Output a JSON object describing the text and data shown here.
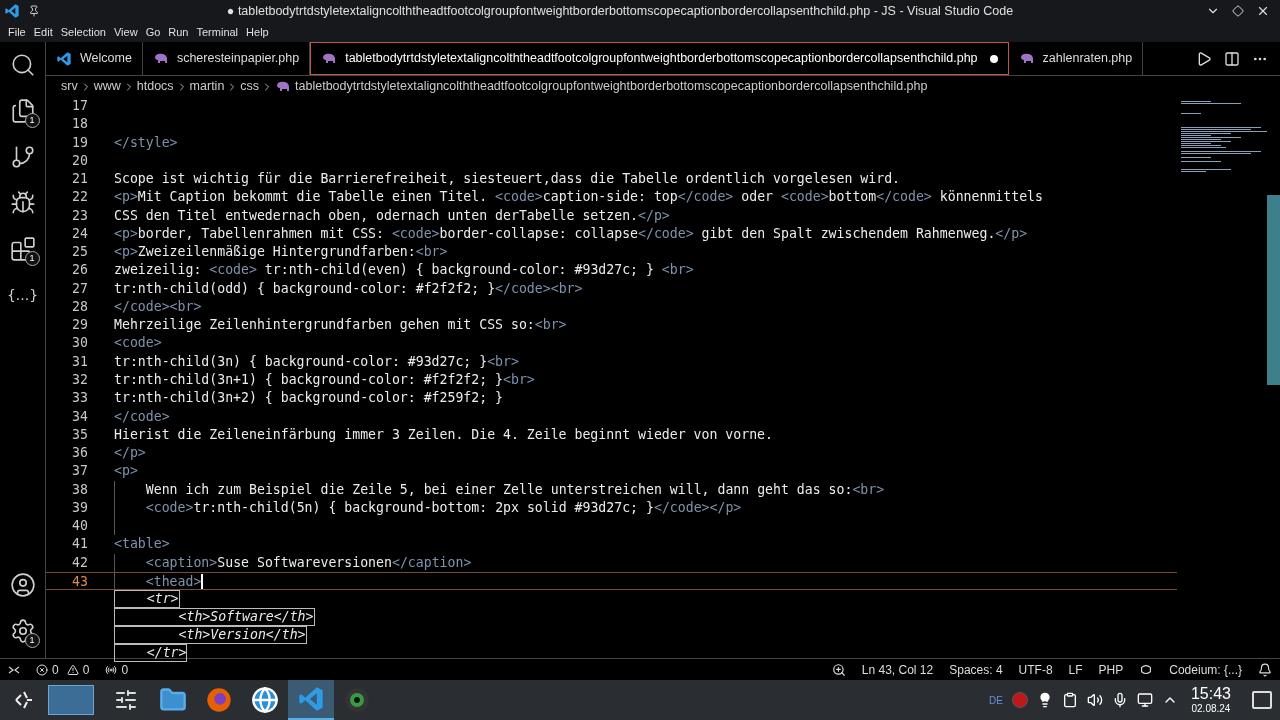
{
  "window": {
    "title": "● tabletbodytrtdstyletextaligncolththeadtfootcolgroupfontweightborderbottomscopecaptionbordercollapsenthchild.php - JS - Visual Studio Code"
  },
  "menu": [
    "File",
    "Edit",
    "Selection",
    "View",
    "Go",
    "Run",
    "Terminal",
    "Help"
  ],
  "activity_bar": [
    {
      "kind": "search"
    },
    {
      "kind": "files",
      "badge": "1"
    },
    {
      "kind": "source-control"
    },
    {
      "kind": "debug"
    },
    {
      "kind": "extensions",
      "badge": "1"
    },
    {
      "kind": "json",
      "label": "{...}"
    }
  ],
  "activity_bar_bottom": [
    {
      "kind": "account"
    },
    {
      "kind": "settings",
      "badge": "1"
    }
  ],
  "tabs": [
    {
      "label": "Welcome",
      "kind": "vscode",
      "selected": false,
      "modified": false
    },
    {
      "label": "scheresteinpapier.php",
      "kind": "php",
      "selected": false,
      "modified": false
    },
    {
      "label": "tabletbodytrtdstyletextaligncolththeadtfootcolgroupfontweightborderbottomscopecaptionbordercollapsenthchild.php",
      "kind": "php",
      "selected": true,
      "modified": true
    },
    {
      "label": "zahlenraten.php",
      "kind": "php",
      "selected": false,
      "modified": false
    }
  ],
  "breadcrumbs": [
    "srv",
    "www",
    "htdocs",
    "martin",
    "css",
    "tabletbodytrtdstyletextaligncolththeadtfootcolgroupfontweightborderbottomscopecaptionbordercollapsenthchild.php"
  ],
  "lines": [
    {
      "number": "17",
      "guide": false,
      "current": false
    },
    {
      "number": "18",
      "guide": false,
      "current": false
    },
    {
      "number": "19",
      "guide": false,
      "current": false,
      "segments": [
        {
          "kind": "tag",
          "text": "</style>"
        }
      ]
    },
    {
      "number": "20",
      "guide": false,
      "current": false
    },
    {
      "number": "21",
      "guide": false,
      "current": false,
      "segments": [
        {
          "kind": "text",
          "text": "Scope ist wichtig für die Barrierefreiheit, siesteuert,dass die Tabelle ordentlich vorgelesen wird."
        }
      ]
    },
    {
      "number": "22",
      "guide": false,
      "current": false,
      "segments": [
        {
          "kind": "tag",
          "text": "<p>"
        },
        {
          "kind": "text",
          "text": "Mit Caption bekommt die Tabelle einen Titel. "
        },
        {
          "kind": "tag",
          "text": "<code>"
        },
        {
          "kind": "text",
          "text": "caption-side: top"
        },
        {
          "kind": "tag",
          "text": "</code>"
        },
        {
          "kind": "text",
          "text": " oder "
        },
        {
          "kind": "tag",
          "text": "<code>"
        },
        {
          "kind": "text",
          "text": "bottom"
        },
        {
          "kind": "tag",
          "text": "</code>"
        },
        {
          "kind": "text",
          "text": " könnenmittels"
        }
      ]
    },
    {
      "number": "23",
      "guide": false,
      "current": false,
      "segments": [
        {
          "kind": "text",
          "text": "CSS den Titel entwedernach oben, odernach unten derTabelle setzen."
        },
        {
          "kind": "tag",
          "text": "</p>"
        }
      ]
    },
    {
      "number": "24",
      "guide": false,
      "current": false,
      "segments": [
        {
          "kind": "tag",
          "text": "<p>"
        },
        {
          "kind": "text",
          "text": "border, Tabellenrahmen mit CSS: "
        },
        {
          "kind": "tag",
          "text": "<code>"
        },
        {
          "kind": "text",
          "text": "border-collapse: collapse"
        },
        {
          "kind": "tag",
          "text": "</code>"
        },
        {
          "kind": "text",
          "text": " gibt den Spalt zwischendem Rahmenweg."
        },
        {
          "kind": "tag",
          "text": "</p>"
        }
      ]
    },
    {
      "number": "25",
      "guide": false,
      "current": false,
      "segments": [
        {
          "kind": "tag",
          "text": "<p>"
        },
        {
          "kind": "text",
          "text": "Zweizeilenmäßige Hintergrundfarben:"
        },
        {
          "kind": "tag",
          "text": "<br>"
        }
      ]
    },
    {
      "number": "26",
      "guide": false,
      "current": false,
      "segments": [
        {
          "kind": "text",
          "text": "zweizeilig: "
        },
        {
          "kind": "tag",
          "text": "<code>"
        },
        {
          "kind": "text",
          "text": " tr:nth-child(even) { background-color: #93d27c; } "
        },
        {
          "kind": "tag",
          "text": "<br>"
        }
      ]
    },
    {
      "number": "27",
      "guide": false,
      "current": false,
      "segments": [
        {
          "kind": "text",
          "text": "tr:nth-child(odd) { background-color: #f2f2f2; }"
        },
        {
          "kind": "tag",
          "text": "</code>"
        },
        {
          "kind": "tag",
          "text": "<br>"
        }
      ]
    },
    {
      "number": "28",
      "guide": false,
      "current": false,
      "segments": [
        {
          "kind": "tag",
          "text": "</code>"
        },
        {
          "kind": "tag",
          "text": "<br>"
        }
      ]
    },
    {
      "number": "29",
      "guide": false,
      "current": false,
      "segments": [
        {
          "kind": "text",
          "text": "Mehrzeilige Zeilenhintergrundfarben gehen mit CSS so:"
        },
        {
          "kind": "tag",
          "text": "<br>"
        }
      ]
    },
    {
      "number": "30",
      "guide": false,
      "current": false,
      "segments": [
        {
          "kind": "tag",
          "text": "<code>"
        }
      ]
    },
    {
      "number": "31",
      "guide": false,
      "current": false,
      "segments": [
        {
          "kind": "text",
          "text": "tr:nth-child(3n) { background-color: #93d27c; }"
        },
        {
          "kind": "tag",
          "text": "<br>"
        }
      ]
    },
    {
      "number": "32",
      "guide": false,
      "current": false,
      "segments": [
        {
          "kind": "text",
          "text": "tr:nth-child(3n+1) { background-color: #f2f2f2; }"
        },
        {
          "kind": "tag",
          "text": "<br>"
        }
      ]
    },
    {
      "number": "33",
      "guide": false,
      "current": false,
      "segments": [
        {
          "kind": "text",
          "text": "tr:nth-child(3n+2) { background-color: #f259f2; }"
        }
      ]
    },
    {
      "number": "34",
      "guide": false,
      "current": false,
      "segments": [
        {
          "kind": "tag",
          "text": "</code>"
        }
      ]
    },
    {
      "number": "35",
      "guide": false,
      "current": false,
      "segments": [
        {
          "kind": "text",
          "text": "Hierist die Zeileneinfärbung immer 3 Zeilen. Die 4. Zeile beginnt wieder von vorne."
        }
      ]
    },
    {
      "number": "36",
      "guide": false,
      "current": false,
      "segments": [
        {
          "kind": "tag",
          "text": "</p>"
        }
      ]
    },
    {
      "number": "37",
      "guide": false,
      "current": false,
      "segments": [
        {
          "kind": "tag",
          "text": "<p>"
        }
      ]
    },
    {
      "number": "38",
      "guide": true,
      "current": false,
      "segments": [
        {
          "kind": "text",
          "text": "Wenn ich zum Beispiel die Zeile 5, bei einer Zelle unterstreichen will, dann geht das so:"
        },
        {
          "kind": "tag",
          "text": "<br>"
        }
      ]
    },
    {
      "number": "39",
      "guide": true,
      "current": false,
      "segments": [
        {
          "kind": "tag",
          "text": "<code>"
        },
        {
          "kind": "text",
          "text": "tr:nth-child(5n) { background-bottom: 2px solid #93d27c; }"
        },
        {
          "kind": "tag",
          "text": "</code>"
        },
        {
          "kind": "tag",
          "text": "</p>"
        }
      ]
    },
    {
      "number": "40",
      "guide": true,
      "current": false
    },
    {
      "number": "41",
      "guide": false,
      "current": false,
      "segments": [
        {
          "kind": "tag",
          "text": "<table>"
        }
      ]
    },
    {
      "number": "42",
      "guide": true,
      "current": false,
      "segments": [
        {
          "kind": "tag",
          "text": "<caption>"
        },
        {
          "kind": "text",
          "text": "Suse Softwareversionen"
        },
        {
          "kind": "tag",
          "text": "</caption>"
        }
      ]
    },
    {
      "number": "43",
      "guide": true,
      "current": true,
      "segments": [
        {
          "kind": "tag",
          "text": "<thead>"
        }
      ]
    }
  ],
  "suggestion": [
    "    <tr>",
    "        <th>Software</th>",
    "        <th>Version</th>",
    "    </tr>"
  ],
  "status_bar": {
    "errors": "0",
    "warnings": "0",
    "ports": "0",
    "right": [
      "Ln 43, Col 12",
      "Spaces: 4",
      "UTF-8",
      "LF",
      "PHP"
    ],
    "codeium": "Codeium: {...}"
  },
  "taskbar": {
    "apps": [
      {
        "kind": "files",
        "selected": false
      },
      {
        "kind": "firefox",
        "selected": false
      },
      {
        "kind": "globe",
        "selected": false
      },
      {
        "kind": "vscode",
        "selected": true
      },
      {
        "kind": "camera",
        "selected": false
      }
    ],
    "language": "DE",
    "time": "15:43",
    "date": "02.08.24"
  }
}
